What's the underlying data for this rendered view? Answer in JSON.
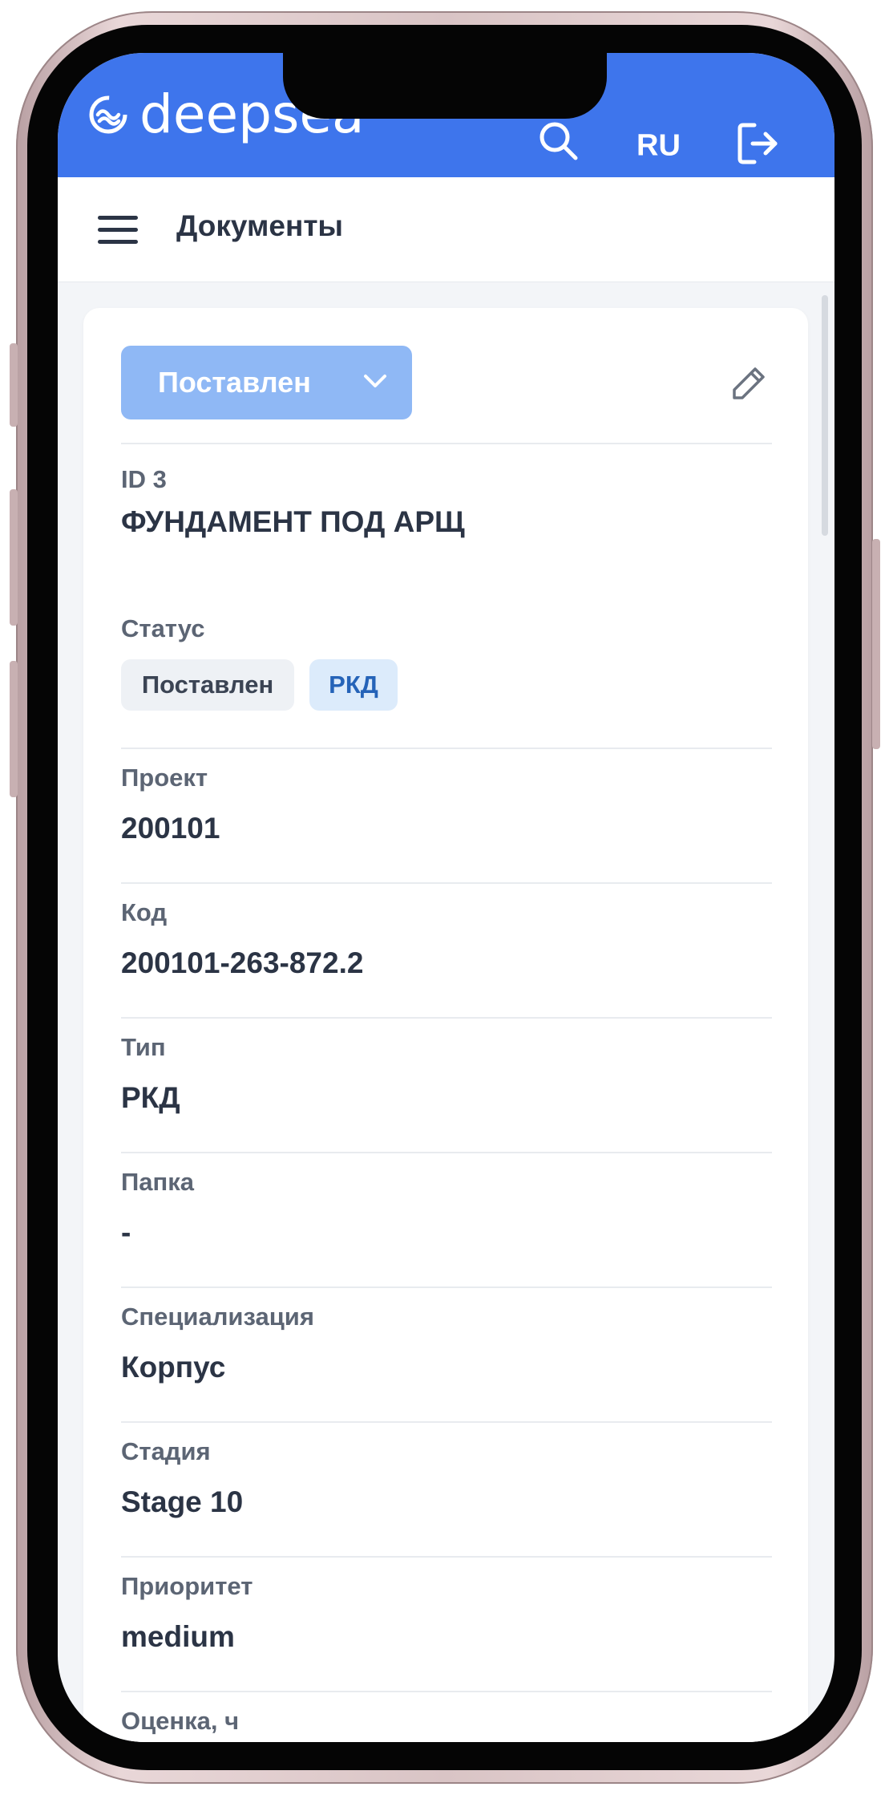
{
  "app_bar": {
    "logo_text": "deepsea",
    "search_icon": "search-icon",
    "language": "RU",
    "logout_icon": "logout-icon",
    "color": "#3e75ec"
  },
  "header": {
    "menu_icon": "hamburger-menu-icon",
    "title": "Документы"
  },
  "card": {
    "status_dropdown": {
      "label": "Поставлен",
      "icon": "chevron-down-icon",
      "color": "#8fb8f5"
    },
    "edit_icon": "pencil-icon",
    "id_line": "ID 3",
    "document_title": "ФУНДАМЕНТ ПОД АРЩ",
    "status_label": "Статус",
    "status_chips": [
      "Поставлен",
      "РКД"
    ],
    "fields": [
      {
        "label": "Проект",
        "value": "200101"
      },
      {
        "label": "Код",
        "value": "200101-263-872.2"
      },
      {
        "label": "Тип",
        "value": "РКД"
      },
      {
        "label": "Папка",
        "value": "-"
      },
      {
        "label": "Специализация",
        "value": "Корпус"
      },
      {
        "label": "Стадия",
        "value": "Stage 10"
      },
      {
        "label": "Приоритет",
        "value": "medium"
      },
      {
        "label": "Оценка, ч",
        "value": "-"
      }
    ]
  }
}
